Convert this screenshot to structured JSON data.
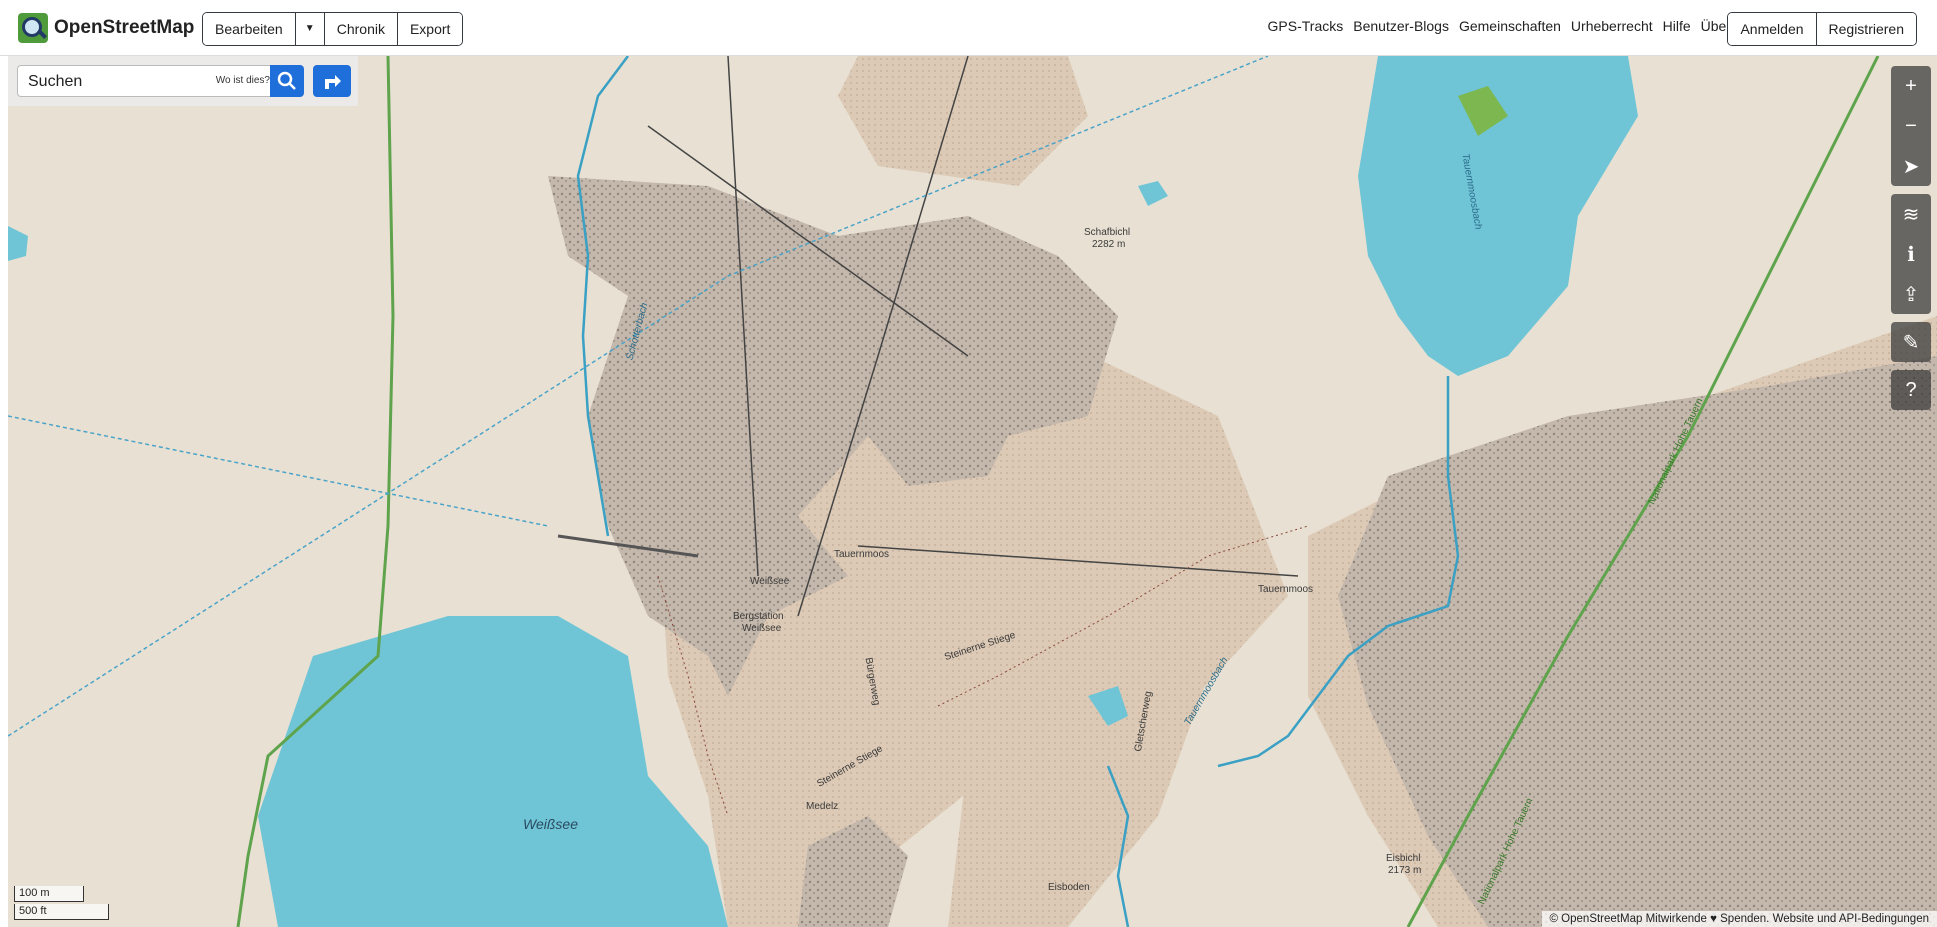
{
  "header": {
    "logo_text": "OpenStreetMap",
    "edit_label": "Bearbeiten",
    "history_label": "Chronik",
    "export_label": "Export",
    "nav": [
      "GPS-Tracks",
      "Benutzer-Blogs",
      "Gemeinschaften",
      "Urheberrecht",
      "Hilfe",
      "Über"
    ],
    "login_label": "Anmelden",
    "register_label": "Registrieren"
  },
  "search": {
    "value": "Suchen",
    "what_is_here": "Wo ist dies?"
  },
  "map_controls": [
    "zoom-in",
    "zoom-out",
    "locate",
    "layers",
    "info",
    "share",
    "add-note",
    "query"
  ],
  "scale": {
    "meters": "100 m",
    "feet": "500 ft"
  },
  "attribution": "© OpenStreetMap Mitwirkende ♥ Spenden. Website und API-Bedingungen",
  "labels": {
    "weissee_lake": "Weißsee",
    "schafbichl": "Schafbichl",
    "schafbichl_elev": "2282 m",
    "tauernmoos": "Tauernmoos",
    "tauernmoos2": "Tauernmoos",
    "weissee_station": "Weißsee",
    "bergstation": "Bergstation",
    "bergstation2": "Weißsee",
    "steinerne_stiege": "Steinerne Stiege",
    "steinerne_stiege2": "Steinerne Stiege",
    "medelz": "Medelz",
    "eisboden": "Eisboden",
    "eisbichl": "Eisbichl",
    "eisbichl_elev": "2173 m",
    "schotterbach": "Schotterbach",
    "tauernmoosbach": "Tauernmoosbach",
    "tauernmoosbach2": "Tauernmoosbach",
    "np_hohe_tauern": "Nationalpark Hohe Tauern",
    "np_hohe_tauern2": "Nationalpark Hohe Tauern",
    "gletscherweg": "Gletscherweg",
    "buerschweg": "Bürgerweg"
  },
  "colors": {
    "land": "#e8e1d3",
    "scree": "#d8c6b1",
    "rock": "#b9aea3",
    "water": "#6fc5d6",
    "park_border": "#5fa34c",
    "accent_blue": "#1e6fd9"
  }
}
